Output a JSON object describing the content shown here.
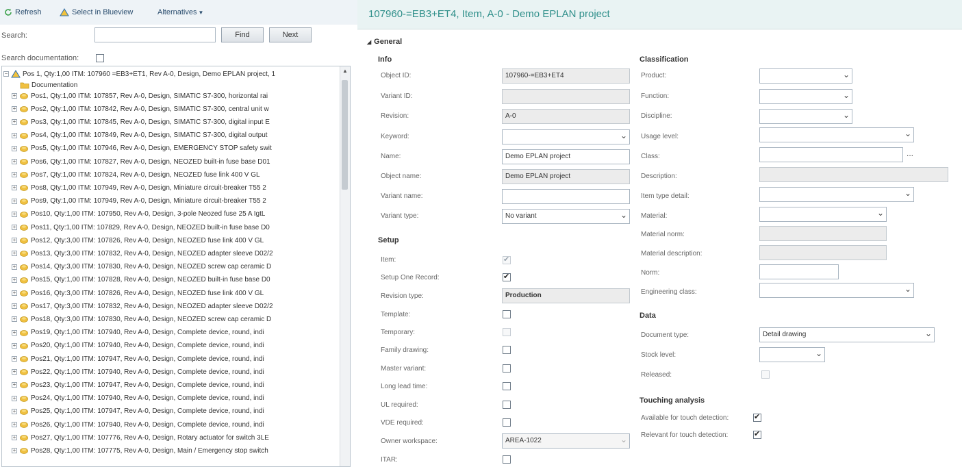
{
  "toolbar": {
    "refresh_label": "Refresh",
    "select_blueview_label": "Select in Blueview",
    "alternatives_label": "Alternatives"
  },
  "search": {
    "label": "Search:",
    "value": "",
    "find_label": "Find",
    "next_label": "Next",
    "documentation_label": "Search documentation:",
    "documentation_checked": false
  },
  "tree": {
    "root": "Pos 1, Qty:1,00 ITM: 107960 =EB3+ET1, Rev A-0, Design, Demo EPLAN project, 1",
    "documentation": "Documentation",
    "items": [
      "Pos1, Qty:1,00 ITM: 107857, Rev A-0, Design, SIMATIC S7-300, horizontal rai",
      "Pos2, Qty:1,00 ITM: 107842, Rev A-0, Design, SIMATIC S7-300, central unit w",
      "Pos3, Qty:1,00 ITM: 107845, Rev A-0, Design, SIMATIC S7-300, digital input E",
      "Pos4, Qty:1,00 ITM: 107849, Rev A-0, Design, SIMATIC S7-300, digital output",
      "Pos5, Qty:1,00 ITM: 107946, Rev A-0, Design, EMERGENCY STOP safety swit",
      "Pos6, Qty:1,00 ITM: 107827, Rev A-0, Design, NEOZED built-in fuse base D01",
      "Pos7, Qty:1,00 ITM: 107824, Rev A-0, Design, NEOZED fuse link 400 V GL",
      "Pos8, Qty:1,00 ITM: 107949, Rev A-0, Design, Miniature circuit-breaker T55 2",
      "Pos9, Qty:1,00 ITM: 107949, Rev A-0, Design, Miniature circuit-breaker T55 2",
      "Pos10, Qty:1,00 ITM: 107950, Rev A-0, Design, 3-pole Neozed fuse 25 A IgtL",
      "Pos11, Qty:1,00 ITM: 107829, Rev A-0, Design, NEOZED built-in fuse base D0",
      "Pos12, Qty:3,00 ITM: 107826, Rev A-0, Design, NEOZED fuse link 400 V GL",
      "Pos13, Qty:3,00 ITM: 107832, Rev A-0, Design, NEOZED adapter sleeve D02/2",
      "Pos14, Qty:3,00 ITM: 107830, Rev A-0, Design, NEOZED screw cap ceramic D",
      "Pos15, Qty:1,00 ITM: 107828, Rev A-0, Design, NEOZED built-in fuse base D0",
      "Pos16, Qty:3,00 ITM: 107826, Rev A-0, Design, NEOZED fuse link 400 V GL",
      "Pos17, Qty:3,00 ITM: 107832, Rev A-0, Design, NEOZED adapter sleeve D02/2",
      "Pos18, Qty:3,00 ITM: 107830, Rev A-0, Design, NEOZED screw cap ceramic D",
      "Pos19, Qty:1,00 ITM: 107940, Rev A-0, Design, Complete device, round, indi",
      "Pos20, Qty:1,00 ITM: 107940, Rev A-0, Design, Complete device, round, indi",
      "Pos21, Qty:1,00 ITM: 107947, Rev A-0, Design, Complete device, round, indi",
      "Pos22, Qty:1,00 ITM: 107940, Rev A-0, Design, Complete device, round, indi",
      "Pos23, Qty:1,00 ITM: 107947, Rev A-0, Design, Complete device, round, indi",
      "Pos24, Qty:1,00 ITM: 107940, Rev A-0, Design, Complete device, round, indi",
      "Pos25, Qty:1,00 ITM: 107947, Rev A-0, Design, Complete device, round, indi",
      "Pos26, Qty:1,00 ITM: 107940, Rev A-0, Design, Complete device, round, indi",
      "Pos27, Qty:1,00 ITM: 107776, Rev A-0, Design, Rotary actuator for switch 3LE",
      "Pos28, Qty:1,00 ITM: 107775, Rev A-0, Design, Main / Emergency stop switch"
    ]
  },
  "page_title": "107960-=EB3+ET4, Item, A-0 - Demo EPLAN project",
  "general": {
    "heading": "General",
    "info": {
      "heading": "Info",
      "object_id_label": "Object ID:",
      "object_id": "107960-=EB3+ET4",
      "variant_id_label": "Variant ID:",
      "variant_id": "",
      "revision_label": "Revision:",
      "revision": "A-0",
      "keyword_label": "Keyword:",
      "keyword": "",
      "name_label": "Name:",
      "name": "Demo EPLAN project",
      "object_name_label": "Object name:",
      "object_name": "Demo EPLAN project",
      "variant_name_label": "Variant name:",
      "variant_name": "",
      "variant_type_label": "Variant type:",
      "variant_type": "No variant"
    },
    "setup": {
      "heading": "Setup",
      "item_label": "Item:",
      "setup_one_record_label": "Setup One Record:",
      "revision_type_label": "Revision type:",
      "revision_type": "Production",
      "template_label": "Template:",
      "temporary_label": "Temporary:",
      "family_drawing_label": "Family drawing:",
      "master_variant_label": "Master variant:",
      "long_lead_time_label": "Long lead time:",
      "ul_required_label": "UL required:",
      "vde_required_label": "VDE required:",
      "owner_workspace_label": "Owner workspace:",
      "owner_workspace": "AREA-1022",
      "itar_label": "ITAR:"
    },
    "classification": {
      "heading": "Classification",
      "product_label": "Product:",
      "function_label": "Function:",
      "discipline_label": "Discipline:",
      "usage_level_label": "Usage level:",
      "class_label": "Class:",
      "class_ellipsis": "...",
      "description_label": "Description:",
      "item_type_detail_label": "Item type detail:",
      "material_label": "Material:",
      "material_norm_label": "Material norm:",
      "material_description_label": "Material description:",
      "norm_label": "Norm:",
      "engineering_class_label": "Engineering class:"
    },
    "data": {
      "heading": "Data",
      "document_type_label": "Document type:",
      "document_type": "Detail drawing",
      "stock_level_label": "Stock level:",
      "released_label": "Released:"
    },
    "touching": {
      "heading": "Touching analysis",
      "available_label": "Available for touch detection:",
      "relevant_label": "Relevant for touch detection:"
    }
  },
  "colors": {
    "title": "#2f8f8a",
    "toolbar_text": "#2a4d6e",
    "folder": "#f0c040"
  }
}
